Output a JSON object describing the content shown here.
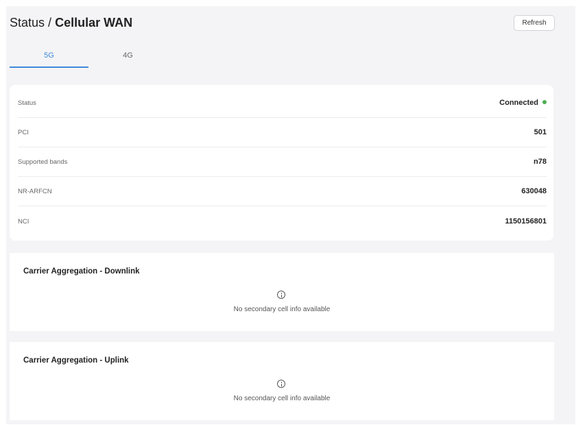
{
  "header": {
    "breadcrumb_parent": "Status",
    "breadcrumb_separator": "/",
    "breadcrumb_current": "Cellular WAN",
    "refresh_label": "Refresh"
  },
  "tabs": [
    {
      "label": "5G",
      "active": true
    },
    {
      "label": "4G",
      "active": false
    }
  ],
  "status_rows": [
    {
      "label": "Status",
      "value": "Connected",
      "indicator_color": "#4caf50"
    },
    {
      "label": "PCI",
      "value": "501"
    },
    {
      "label": "Supported bands",
      "value": "n78"
    },
    {
      "label": "NR-ARFCN",
      "value": "630048"
    },
    {
      "label": "NCI",
      "value": "1150156801"
    }
  ],
  "carrier_aggregation": [
    {
      "title": "Carrier Aggregation - Downlink",
      "icon": "info-icon",
      "message": "No secondary cell info available"
    },
    {
      "title": "Carrier Aggregation - Uplink",
      "icon": "info-icon",
      "message": "No secondary cell info available"
    }
  ],
  "colors": {
    "accent": "#3f88d8",
    "connected": "#4caf50",
    "background": "#f4f4f6"
  }
}
